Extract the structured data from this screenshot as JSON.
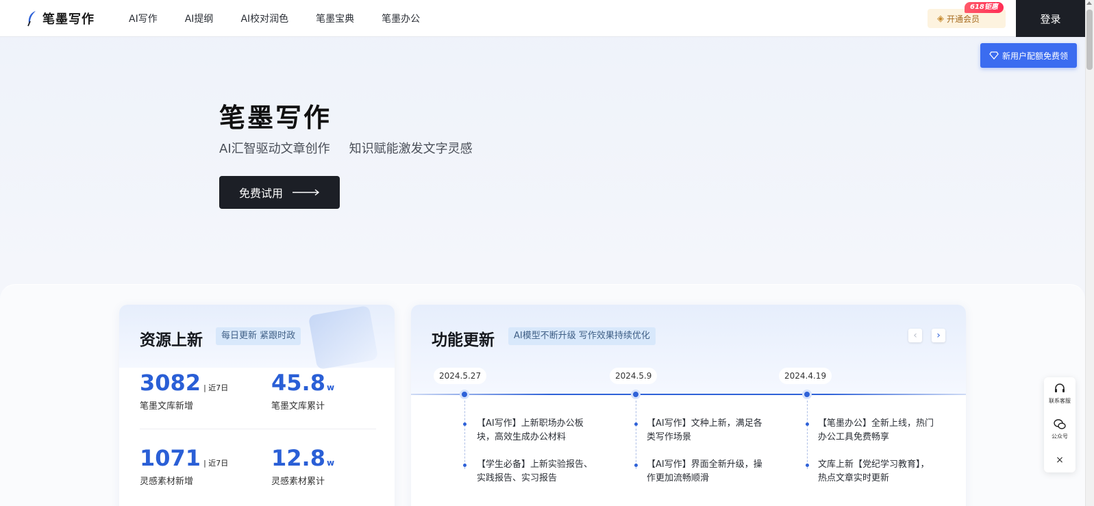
{
  "nav": {
    "logo_text": "笔墨写作",
    "items": [
      "AI写作",
      "AI提纲",
      "AI校对润色",
      "笔墨宝典",
      "笔墨办公"
    ],
    "vip_label": "开通会员",
    "promo_badge": "618钜惠",
    "login_label": "登录",
    "newuser_label": "新用户配额免费领"
  },
  "hero": {
    "title": "笔墨写作",
    "subtitle_a": "AI汇智驱动文章创作",
    "subtitle_b": "知识赋能激发文字灵感",
    "cta_label": "免费试用"
  },
  "resources": {
    "title": "资源上新",
    "tag": "每日更新 紧跟时政",
    "stats": [
      {
        "value": "3082",
        "suffix": "| 近7日",
        "label": "笔墨文库新增"
      },
      {
        "value": "45.8",
        "unit": "w",
        "label": "笔墨文库累计"
      },
      {
        "value": "1071",
        "suffix": "| 近7日",
        "label": "灵感素材新增"
      },
      {
        "value": "12.8",
        "unit": "w",
        "label": "灵感素材累计"
      }
    ]
  },
  "features": {
    "title": "功能更新",
    "tag": "AI模型不断升级 写作效果持续优化",
    "timeline": [
      {
        "date": "2024.5.27",
        "items": [
          "【AI写作】上新职场办公板块，高效生成办公材料",
          "【学生必备】上新实验报告、实践报告、实习报告"
        ]
      },
      {
        "date": "2024.5.9",
        "items": [
          "【AI写作】文种上新，满足各类写作场景",
          "【AI写作】界面全新升级，操作更加流畅顺滑"
        ]
      },
      {
        "date": "2024.4.19",
        "items": [
          "【笔墨办公】全新上线，热门办公工具免费畅享",
          "文库上新【党纪学习教育】，热点文章实时更新"
        ]
      }
    ]
  },
  "float_bar": {
    "service_label": "联系客服",
    "wechat_label": "公众号",
    "close_label": "×"
  },
  "colors": {
    "accent": "#2f62d8",
    "dark": "#1c1f26",
    "promo": "#ff2d55"
  }
}
